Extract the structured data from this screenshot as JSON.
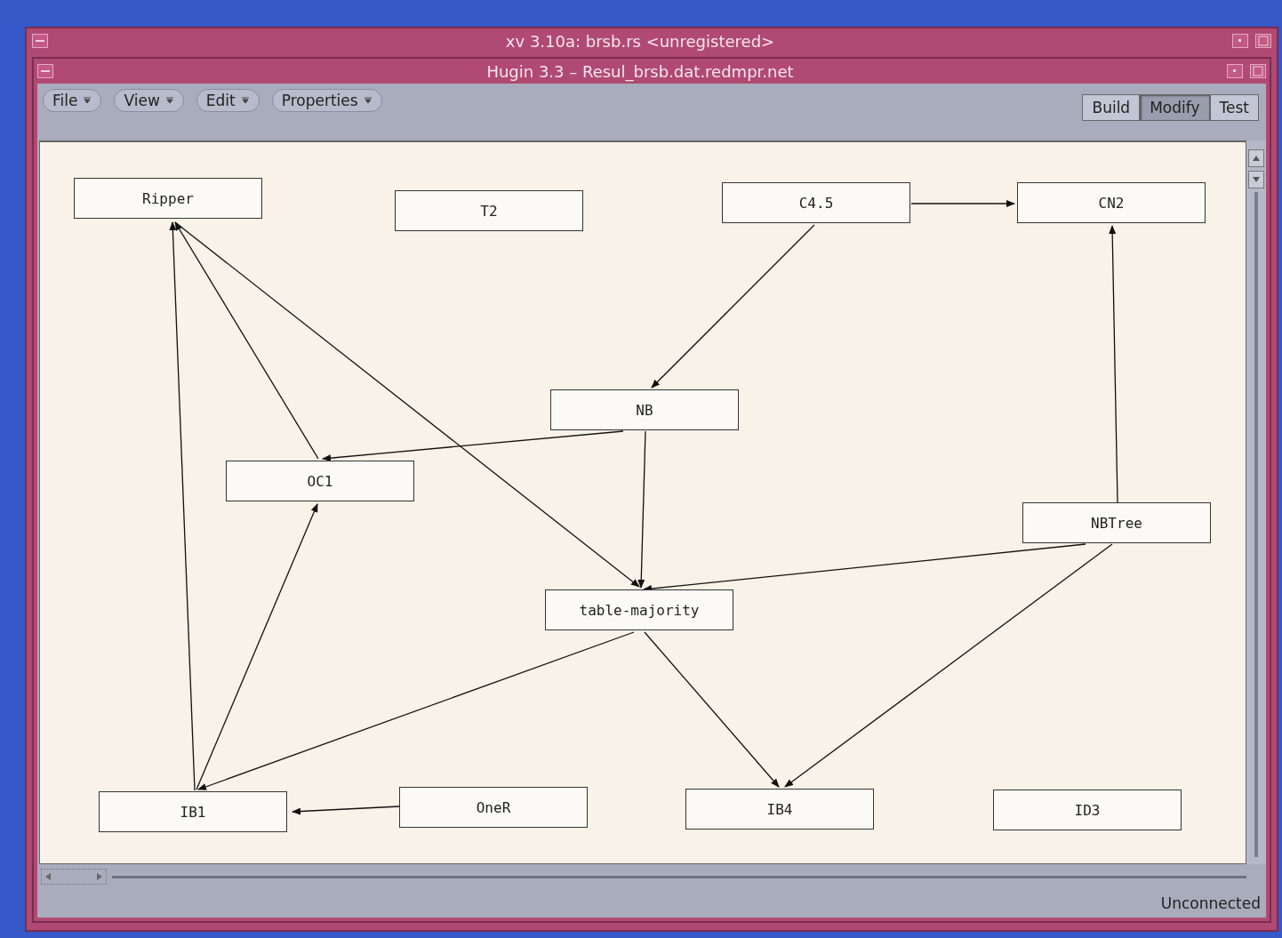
{
  "outer_window": {
    "title": "xv 3.10a: brsb.rs <unregistered>"
  },
  "window": {
    "title": "Hugin 3.3  –  Resul_brsb.dat.redmpr.net"
  },
  "menus": [
    {
      "label": "File"
    },
    {
      "label": "View"
    },
    {
      "label": "Edit"
    },
    {
      "label": "Properties"
    }
  ],
  "modes": [
    {
      "label": "Build",
      "selected": false
    },
    {
      "label": "Modify",
      "selected": true
    },
    {
      "label": "Test",
      "selected": false
    }
  ],
  "nodes": [
    {
      "label": "Ripper"
    },
    {
      "label": "T2"
    },
    {
      "label": "C4.5"
    },
    {
      "label": "CN2"
    },
    {
      "label": "NB"
    },
    {
      "label": "OC1"
    },
    {
      "label": "NBTree"
    },
    {
      "label": "table-majority"
    },
    {
      "label": "IB1"
    },
    {
      "label": "OneR"
    },
    {
      "label": "IB4"
    },
    {
      "label": "ID3"
    }
  ],
  "status_bar": "Unconnected"
}
